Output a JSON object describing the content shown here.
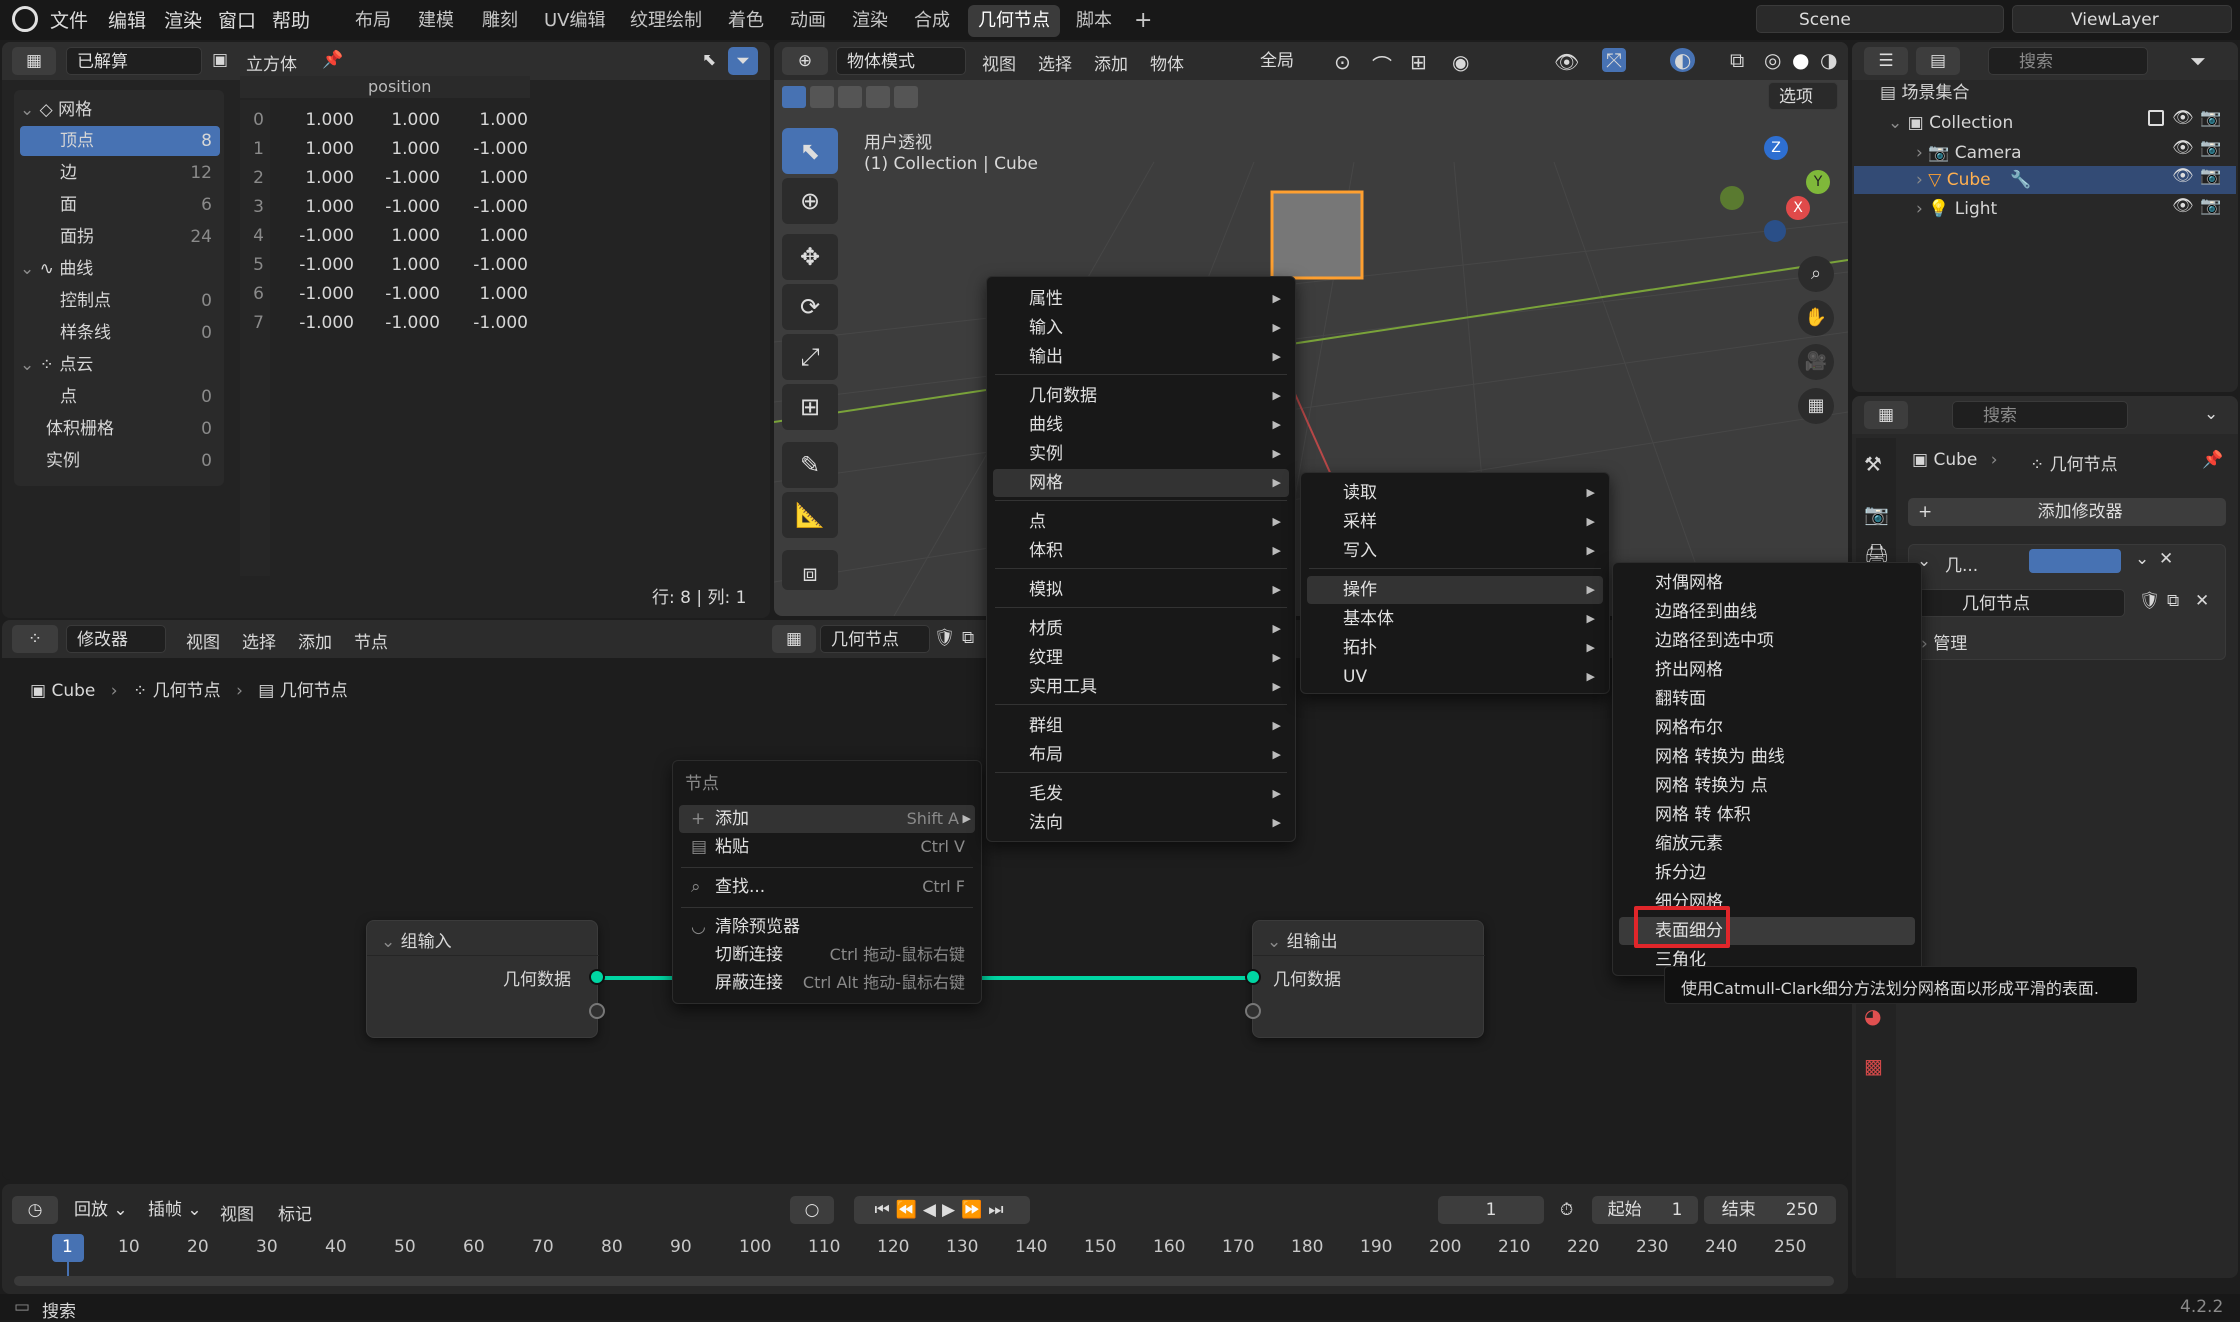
{
  "topbar": {
    "menus": [
      "文件",
      "编辑",
      "渲染",
      "窗口",
      "帮助"
    ],
    "workspaces": [
      "布局",
      "建模",
      "雕刻",
      "UV编辑",
      "纹理绘制",
      "着色",
      "动画",
      "渲染",
      "合成",
      "几何节点",
      "脚本"
    ],
    "active_workspace": "几何节点",
    "add_tab": "+",
    "scene_name": "Scene",
    "view_layer": "ViewLayer"
  },
  "spreadsheet": {
    "state_dropdown": "已解算",
    "object_name": "立方体",
    "column_header": "position",
    "tree": {
      "mesh": {
        "label": "网格",
        "items": [
          {
            "label": "顶点",
            "count": "8"
          },
          {
            "label": "边",
            "count": "12"
          },
          {
            "label": "面",
            "count": "6"
          },
          {
            "label": "面拐",
            "count": "24"
          }
        ]
      },
      "curve": {
        "label": "曲线",
        "items": [
          {
            "label": "控制点",
            "count": "0"
          },
          {
            "label": "样条线",
            "count": "0"
          }
        ]
      },
      "pointcloud": {
        "label": "点云",
        "items": [
          {
            "label": "点",
            "count": "0"
          }
        ]
      },
      "volume": {
        "label": "体积栅格",
        "count": "0"
      },
      "instance": {
        "label": "实例",
        "count": "0"
      }
    },
    "rows": [
      {
        "i": "0",
        "x": "1.000",
        "y": "1.000",
        "z": "1.000"
      },
      {
        "i": "1",
        "x": "1.000",
        "y": "1.000",
        "z": "-1.000"
      },
      {
        "i": "2",
        "x": "1.000",
        "y": "-1.000",
        "z": "1.000"
      },
      {
        "i": "3",
        "x": "1.000",
        "y": "-1.000",
        "z": "-1.000"
      },
      {
        "i": "4",
        "x": "-1.000",
        "y": "1.000",
        "z": "1.000"
      },
      {
        "i": "5",
        "x": "-1.000",
        "y": "1.000",
        "z": "-1.000"
      },
      {
        "i": "6",
        "x": "-1.000",
        "y": "-1.000",
        "z": "1.000"
      },
      {
        "i": "7",
        "x": "-1.000",
        "y": "-1.000",
        "z": "-1.000"
      }
    ],
    "status": "行: 8  |  列: 1"
  },
  "viewport": {
    "mode": "物体模式",
    "menus": [
      "视图",
      "选择",
      "添加",
      "物体"
    ],
    "transform_orientation": "全局",
    "options_label": "选项",
    "view_title": "用户透视",
    "view_subtitle": "(1) Collection | Cube",
    "gizmo": {
      "z": "Z",
      "y": "Y",
      "x": "X"
    }
  },
  "outliner": {
    "search_placeholder": "搜索",
    "scene_collection": "场景集合",
    "collection": "Collection",
    "objects": [
      "Camera",
      "Cube",
      "Light"
    ]
  },
  "properties": {
    "search_placeholder": "搜索",
    "breadcrumb_object": "Cube",
    "breadcrumb_modifier": "几何节点",
    "add_modifier": "添加修改器",
    "modifier_name": "几...",
    "node_group": "几何节点",
    "manage": "管理"
  },
  "node_editor": {
    "editor_type": "修改器",
    "menus": [
      "视图",
      "选择",
      "添加",
      "节点"
    ],
    "node_group": "几何节点",
    "breadcrumb": [
      "Cube",
      "几何节点",
      "几何节点"
    ],
    "group_input": {
      "title": "组输入",
      "socket": "几何数据"
    },
    "group_output": {
      "title": "组输出",
      "socket": "几何数据"
    }
  },
  "node_context_menu": {
    "title": "节点",
    "items": [
      {
        "label": "添加",
        "shortcut": "Shift A"
      },
      {
        "label": "粘贴",
        "shortcut": "Ctrl V"
      },
      {
        "label": "查找...",
        "shortcut": "Ctrl F"
      },
      {
        "label": "清除预览器",
        "shortcut": ""
      },
      {
        "label": "切断连接",
        "shortcut": "Ctrl 拖动-鼠标右键"
      },
      {
        "label": "屏蔽连接",
        "shortcut": "Ctrl Alt 拖动-鼠标右键"
      }
    ]
  },
  "add_menu": {
    "items": [
      "属性",
      "输入",
      "输出",
      "几何数据",
      "曲线",
      "实例",
      "网格",
      "点",
      "体积",
      "模拟",
      "材质",
      "纹理",
      "实用工具",
      "群组",
      "布局",
      "毛发",
      "法向"
    ]
  },
  "mesh_submenu": {
    "items": [
      "读取",
      "采样",
      "写入",
      "操作",
      "基本体",
      "拓扑",
      "UV"
    ]
  },
  "operations_submenu": {
    "items": [
      "对偶网格",
      "边路径到曲线",
      "边路径到选中项",
      "挤出网格",
      "翻转面",
      "网格布尔",
      "网格 转换为 曲线",
      "网格 转换为 点",
      "网格 转 体积",
      "缩放元素",
      "拆分边",
      "细分网格",
      "表面细分",
      "三角化"
    ],
    "highlighted": "表面细分",
    "tooltip": "使用Catmull-Clark细分方法划分网格面以形成平滑的表面."
  },
  "timeline": {
    "menus": [
      "回放",
      "插帧",
      "视图",
      "标记"
    ],
    "current_frame": "1",
    "start_label": "起始",
    "start": "1",
    "end_label": "结束",
    "end": "250",
    "ticks": [
      "1",
      "10",
      "20",
      "30",
      "40",
      "50",
      "60",
      "70",
      "80",
      "90",
      "100",
      "110",
      "120",
      "130",
      "140",
      "150",
      "160",
      "170",
      "180",
      "190",
      "200",
      "210",
      "220",
      "230",
      "240",
      "250"
    ]
  },
  "statusbar": {
    "search": "搜索",
    "version": "4.2.2"
  },
  "colors": {
    "accent": "#4772b3",
    "link": "#00d6a3",
    "highlight_box": "#e0262a",
    "orange": "#ffa030"
  }
}
